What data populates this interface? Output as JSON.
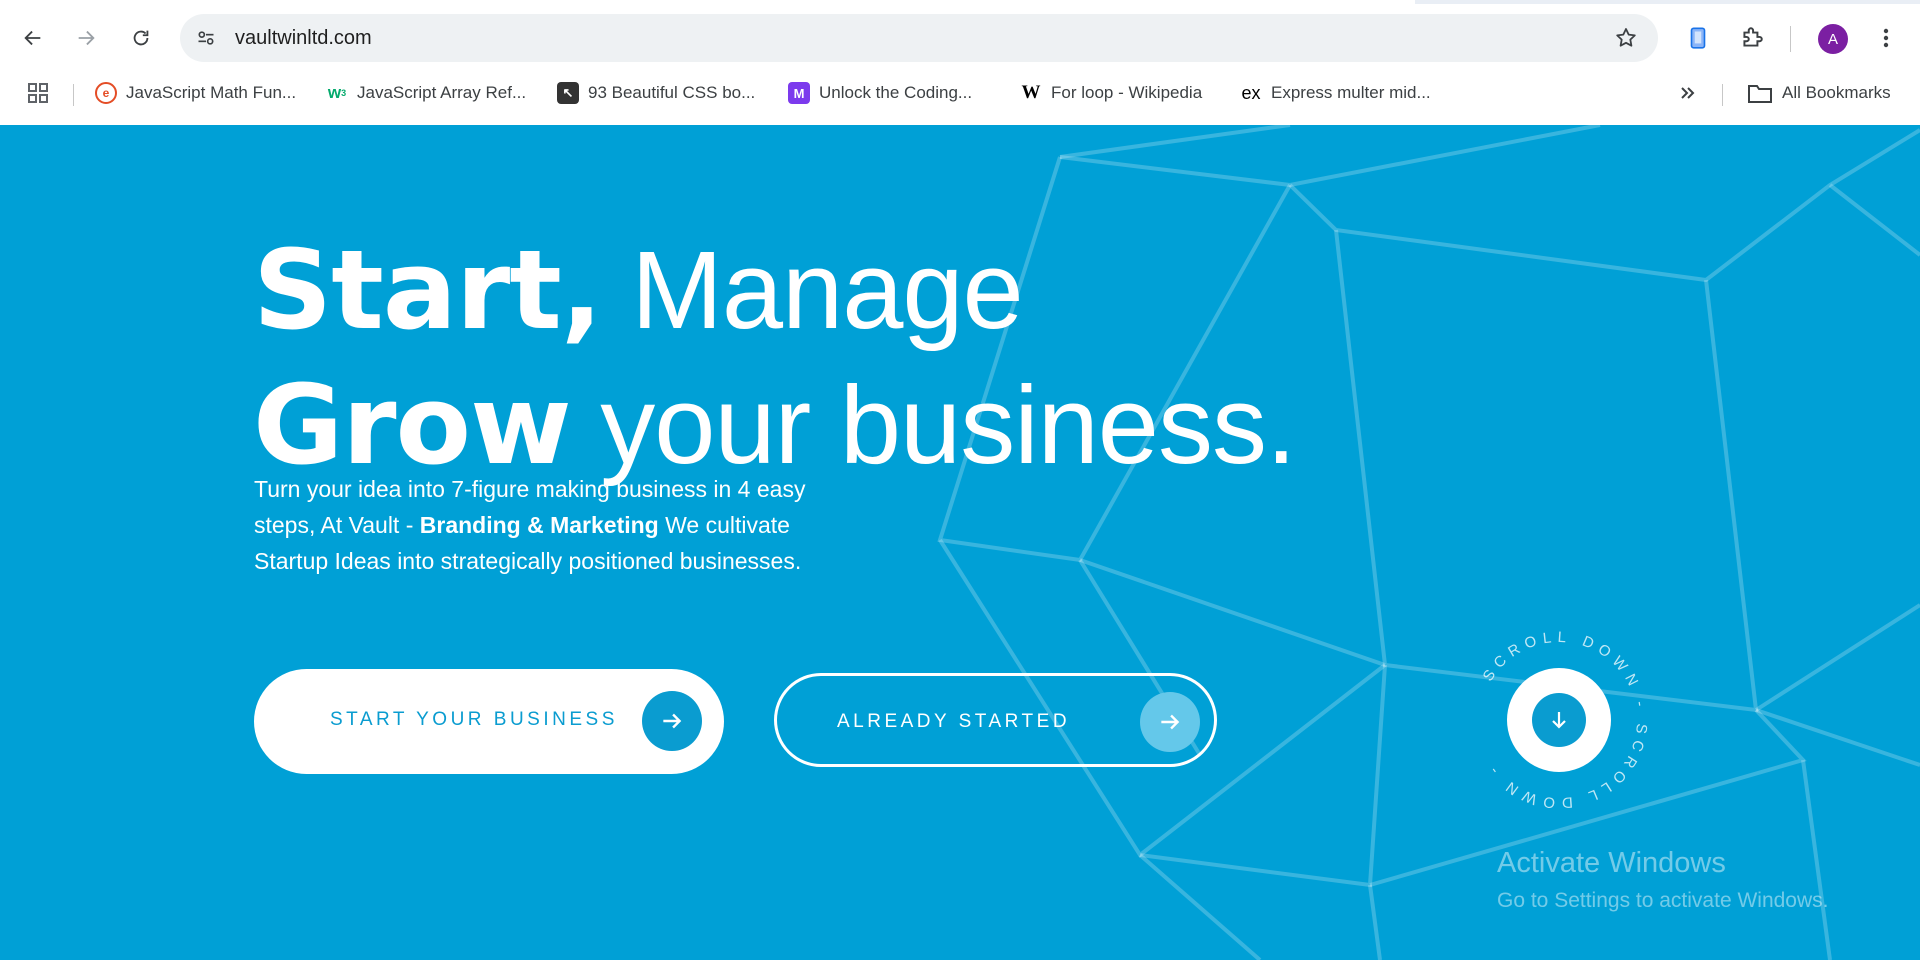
{
  "browser": {
    "url": "vaultwinltd.com",
    "avatar_letter": "A",
    "bookmarks": [
      {
        "label": "JavaScript Math Fun...",
        "icon": "dev-icon",
        "color": "#e44d26"
      },
      {
        "label": "JavaScript Array Ref...",
        "icon": "w3schools-icon",
        "color": "#04aa6d"
      },
      {
        "label": "93 Beautiful CSS bo...",
        "icon": "cursor-icon",
        "color": "#333333"
      },
      {
        "label": "Unlock the Coding...",
        "icon": "coding-icon",
        "color": "#7c3aed"
      },
      {
        "label": "For loop - Wikipedia",
        "icon": "wikipedia-icon",
        "color": "#000000"
      },
      {
        "label": "Express multer mid...",
        "icon": "express-icon",
        "color": "#000000"
      }
    ],
    "all_bookmarks_label": "All Bookmarks"
  },
  "hero": {
    "line1_bold": "Start,",
    "line1_light": " Manage",
    "line2_bold": "Grow",
    "line2_light": " your business.",
    "sub_part1": "Turn your idea into 7-figure making business in 4 easy steps, At Vault - ",
    "sub_bold": "Branding & Marketing",
    "sub_part2": " We cultivate Startup Ideas into strategically positioned businesses.",
    "primary_button": "START YOUR BUSINESS",
    "secondary_button": "ALREADY STARTED",
    "scroll_text": "SCROLL DOWN - SCROLL DOWN - "
  },
  "watermark": {
    "title": "Activate Windows",
    "subtitle": "Go to Settings to activate Windows."
  },
  "colors": {
    "hero_bg": "#00a0d6",
    "accent": "#0a9cd0"
  }
}
